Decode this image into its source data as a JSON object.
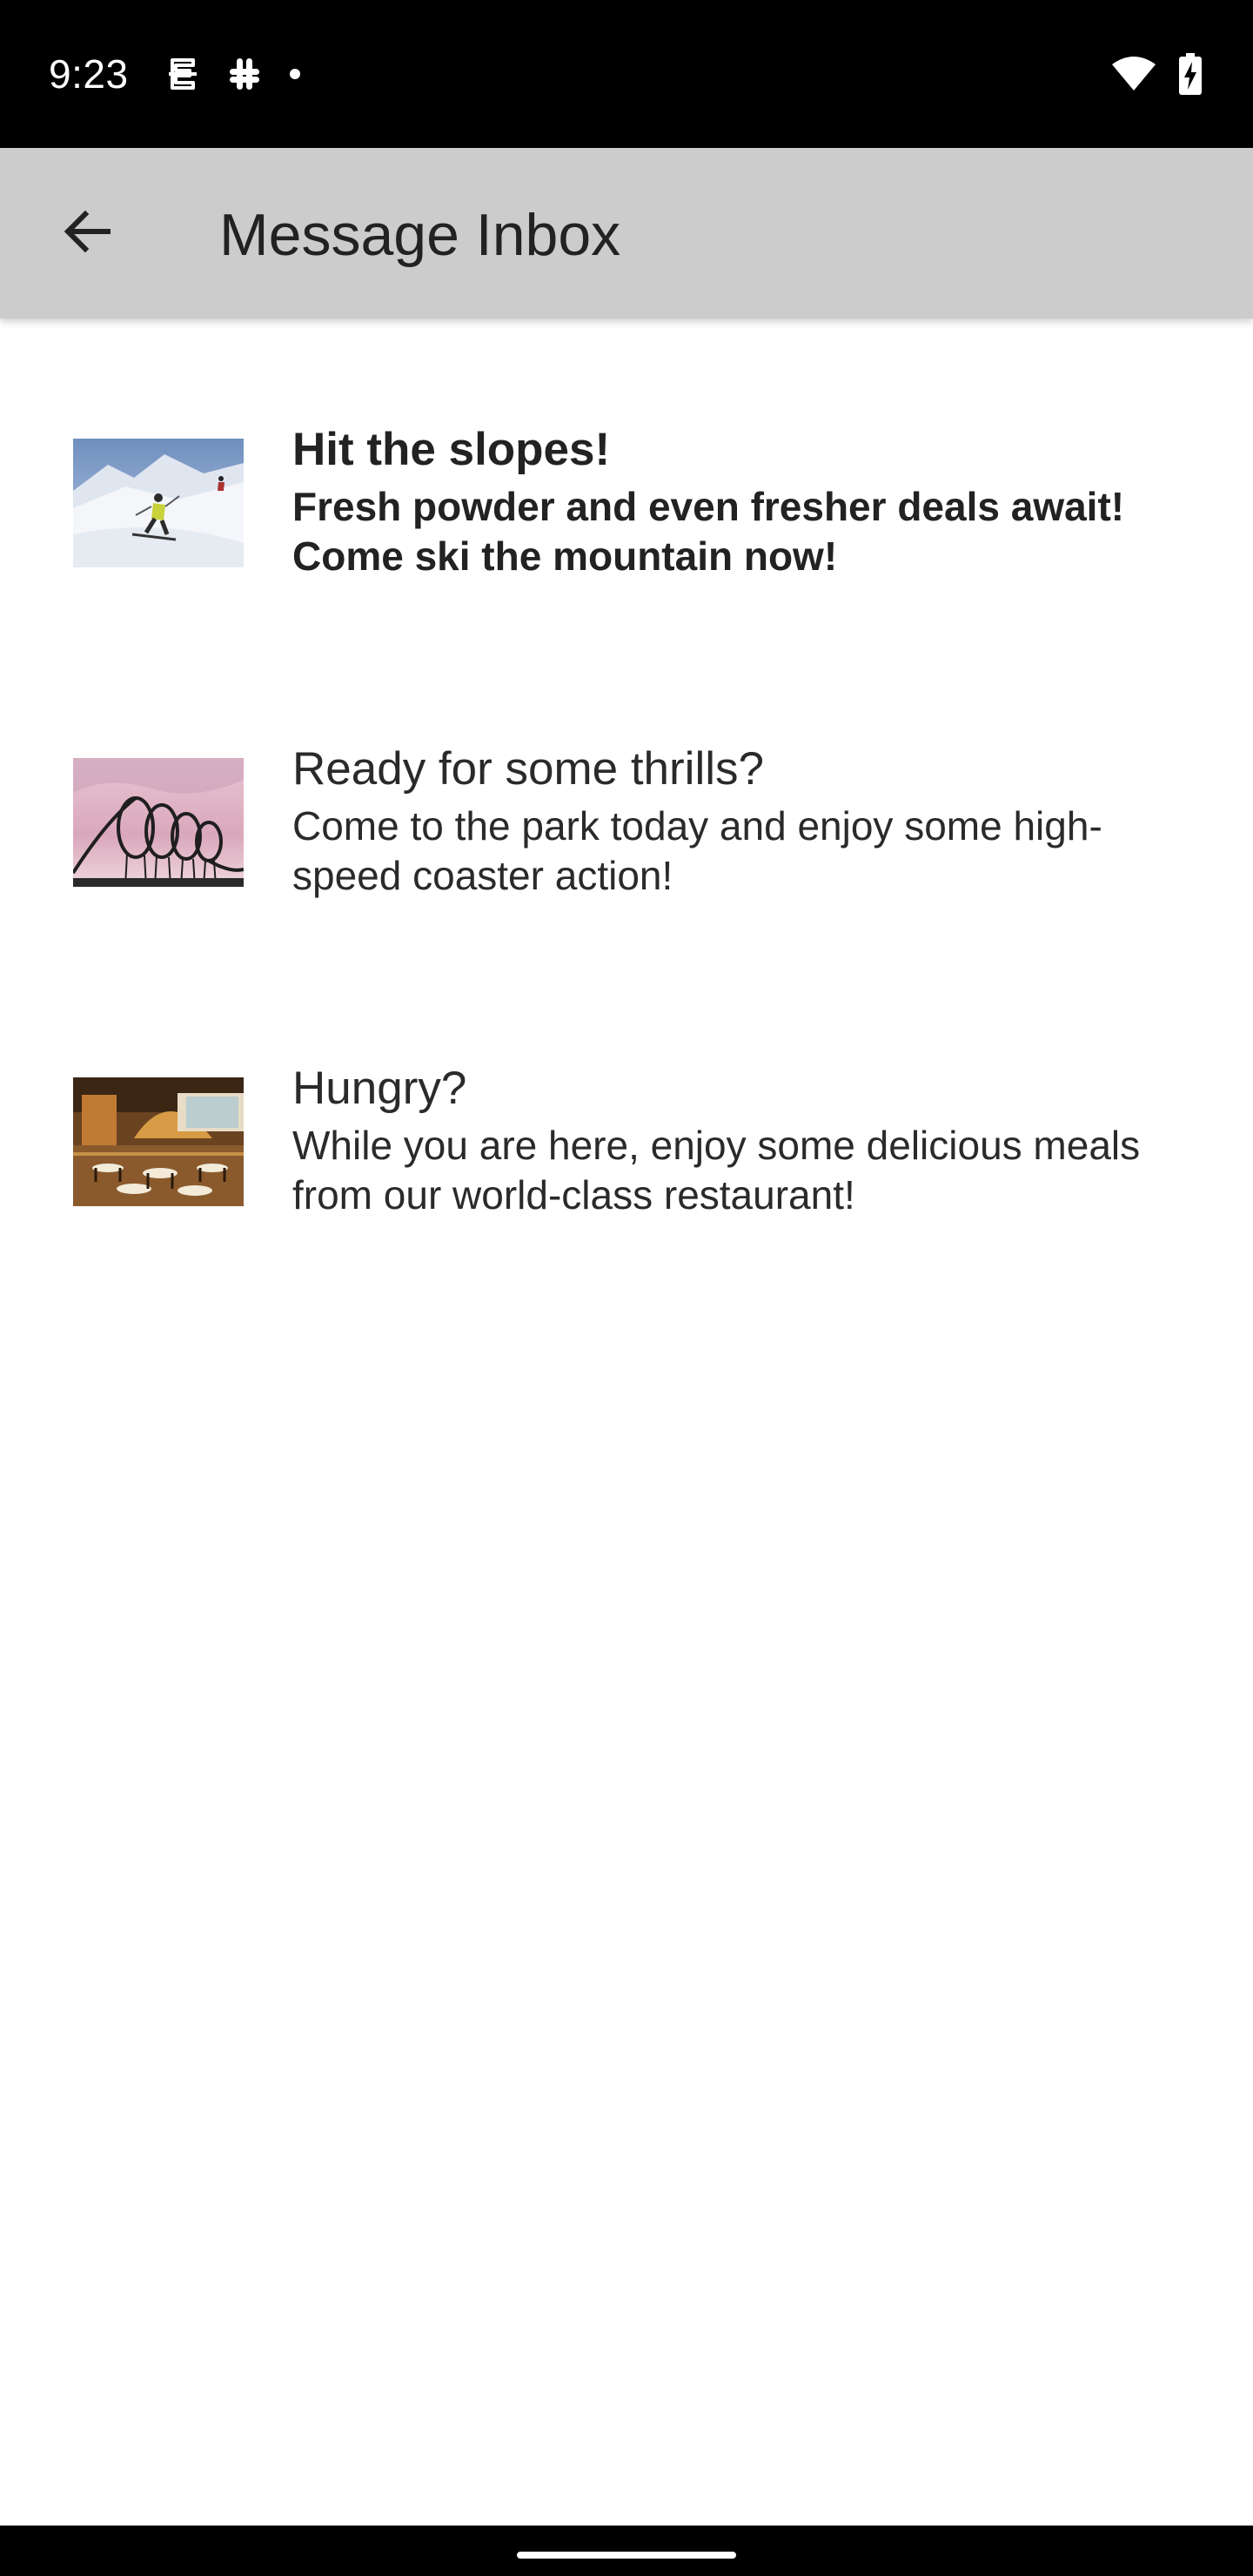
{
  "status_bar": {
    "time": "9:23",
    "icons_left": [
      "notification-icon",
      "slack-icon",
      "dot-icon"
    ],
    "icons_right": [
      "wifi-icon",
      "battery-charging-icon"
    ]
  },
  "app_bar": {
    "back_icon": "arrow-back-icon",
    "title": "Message Inbox",
    "background": "#cccccc"
  },
  "messages": [
    {
      "title": "Hit the slopes!",
      "body": "Fresh powder and even fresher deals await! Come ski the mountain now!",
      "read": false,
      "thumbnail": "skier-image"
    },
    {
      "title": "Ready for some thrills?",
      "body": "Come to the park today and enjoy some high-speed coaster action!",
      "read": true,
      "thumbnail": "roller-coaster-image"
    },
    {
      "title": "Hungry?",
      "body": "While you are here, enjoy some delicious meals from our world-class restaurant!",
      "read": true,
      "thumbnail": "restaurant-image"
    }
  ],
  "colors": {
    "status_bar": "#000000",
    "text": "#222222",
    "background": "#ffffff"
  }
}
